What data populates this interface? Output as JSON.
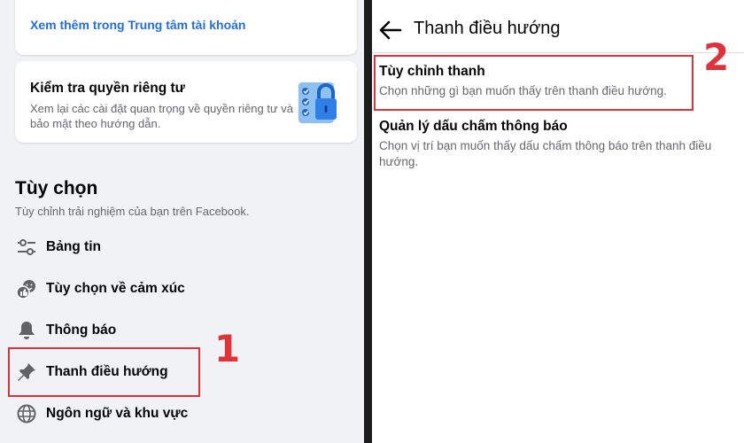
{
  "left": {
    "account_link": "Xem thêm trong Trung tâm tài khoản",
    "privacy_card": {
      "title": "Kiểm tra quyền riêng tư",
      "description": "Xem lại các cài đặt quan trọng về quyền riêng tư và bảo mật theo hướng dẫn.",
      "icon": "privacy-checklist-lock-icon"
    },
    "section": {
      "title": "Tùy chọn",
      "subtitle": "Tùy chỉnh trải nghiệm của bạn trên Facebook."
    },
    "menu": [
      {
        "label": "Bảng tin",
        "icon": "sliders-icon"
      },
      {
        "label": "Tùy chọn về cảm xúc",
        "icon": "reactions-icon"
      },
      {
        "label": "Thông báo",
        "icon": "bell-icon"
      },
      {
        "label": "Thanh điều hướng",
        "icon": "pin-icon"
      },
      {
        "label": "Ngôn ngữ và khu vực",
        "icon": "globe-icon"
      }
    ],
    "step_number": "1"
  },
  "right": {
    "header_title": "Thanh điều hướng",
    "options": [
      {
        "title": "Tùy chỉnh thanh",
        "description": "Chọn những gì bạn muốn thấy trên thanh điều hướng."
      },
      {
        "title": "Quản lý dấu chấm thông báo",
        "description": "Chọn vị trí bạn muốn thấy dấu chấm thông báo trên thanh điều hướng."
      }
    ],
    "step_number": "2"
  },
  "colors": {
    "highlight": "#d9343a",
    "link": "#216fdb",
    "icon_blue": "#3f8ee8"
  }
}
